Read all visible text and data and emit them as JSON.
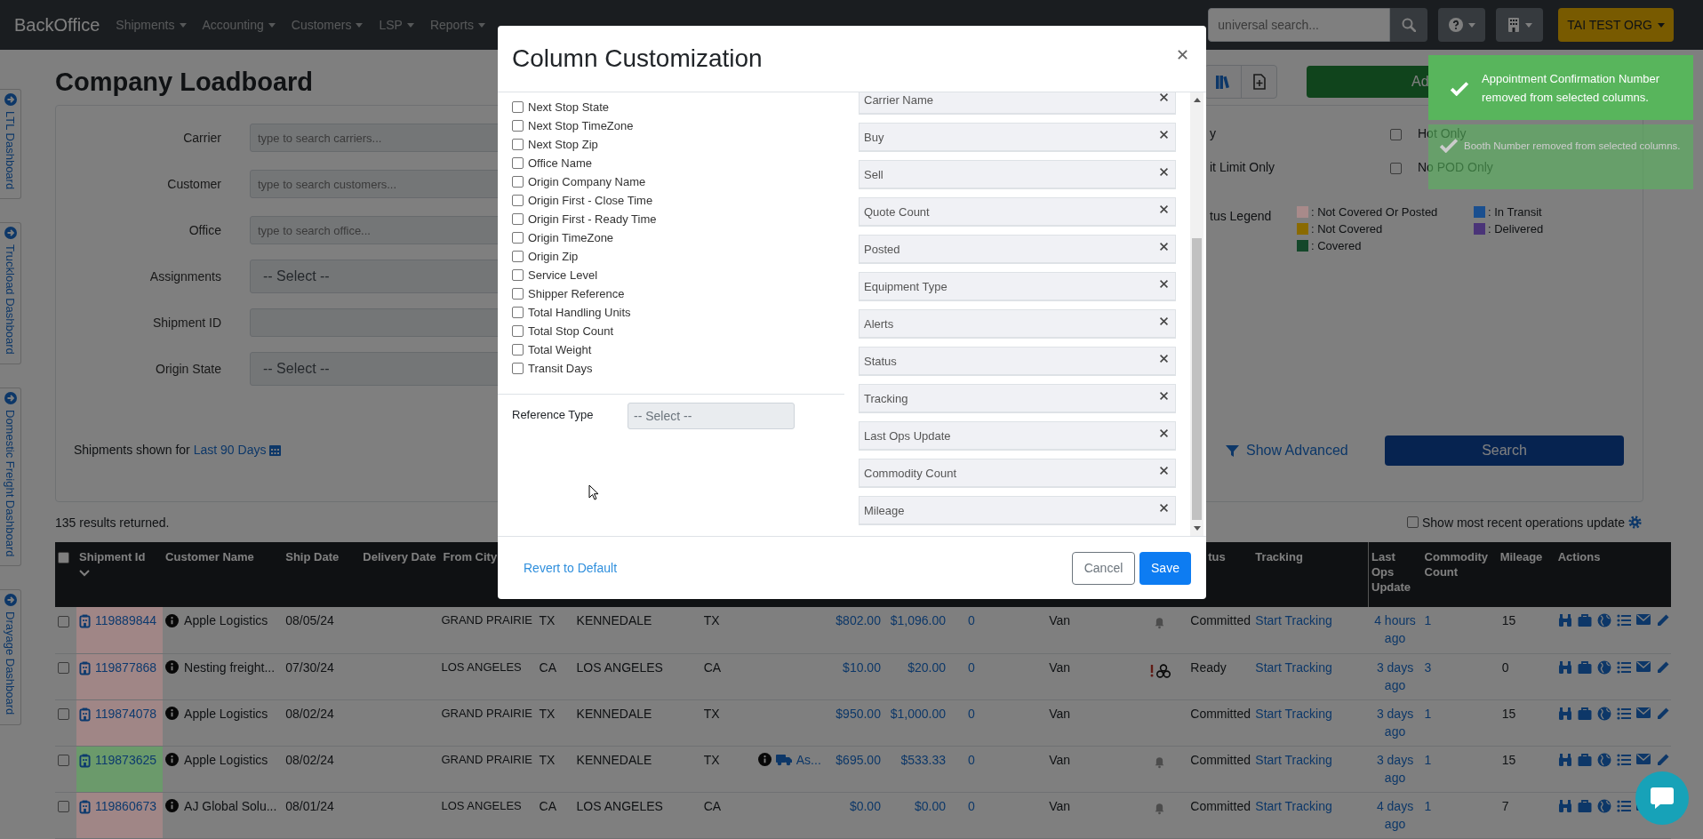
{
  "navbar": {
    "brand": "BackOffice",
    "menus": [
      {
        "label": "Shipments"
      },
      {
        "label": "Accounting"
      },
      {
        "label": "Customers"
      },
      {
        "label": "LSP"
      },
      {
        "label": "Reports"
      }
    ],
    "search": {
      "placeholder": "universal search..."
    },
    "org_button": "TAI TEST ORG"
  },
  "side_tabs": [
    {
      "label": "LTL Dashboard"
    },
    {
      "label": "Truckload Dashboard"
    },
    {
      "label": "Domestic Freight Dashboard"
    },
    {
      "label": "Drayage Dashboard"
    }
  ],
  "page": {
    "title": "Company Loadboard",
    "add_button": "Ad"
  },
  "filters": {
    "fields": [
      {
        "label": "Carrier",
        "kind": "text",
        "placeholder": "type to search carriers..."
      },
      {
        "label": "Customer",
        "kind": "text",
        "placeholder": "type to search customers..."
      },
      {
        "label": "Office",
        "kind": "text",
        "placeholder": "type to search office..."
      },
      {
        "label": "Assignments",
        "kind": "select",
        "value": "-- Select --"
      },
      {
        "label": "Shipment ID",
        "kind": "text"
      },
      {
        "label": "Origin State",
        "kind": "select",
        "value": "-- Select --"
      }
    ],
    "date_range": {
      "text": "Shipments shown for",
      "link": "Last 90 Days"
    },
    "options": [
      {
        "label": "y",
        "checkbox_label": "Hot Only",
        "checked": false
      },
      {
        "label": "it Limit Only",
        "checkbox_label": "No POD Only",
        "checked": false
      }
    ],
    "legend": {
      "label": "tus Legend",
      "items": [
        {
          "label": ": Not Covered Or Posted",
          "color": "#a88a8a"
        },
        {
          "label": ": In Transit",
          "color": "#1a4f8f"
        },
        {
          "label": ": Not Covered",
          "color": "#8a6a00"
        },
        {
          "label": ": Delivered",
          "color": "#4a3478"
        },
        {
          "label": ": Covered",
          "color": "#14472a"
        }
      ]
    },
    "show_advanced": "Show Advanced",
    "search_button": "Search"
  },
  "results": {
    "count": "135 results returned.",
    "recent_ops": {
      "label": "Show most recent operations update",
      "checked": false
    }
  },
  "table": {
    "select_all": {
      "checked": false
    },
    "columns": [
      {
        "label": "Shipment Id",
        "sorted": true
      },
      {
        "label": "Customer Name",
        "sorted": false
      },
      {
        "label": "Ship Date",
        "sorted": false
      },
      {
        "label": "Delivery Date",
        "sorted": false
      },
      {
        "label": "From City",
        "sorted": false
      },
      {
        "label": "tus",
        "sorted": false
      },
      {
        "label": "Tracking",
        "sorted": false
      },
      {
        "label": "Last Ops Update",
        "sorted": false
      },
      {
        "label": "Commodity Count",
        "sorted": false
      },
      {
        "label": "Mileage",
        "sorted": false
      },
      {
        "label": "Actions",
        "sorted": false
      }
    ],
    "rows": [
      {
        "checked": false,
        "id": "119889844",
        "color": "#a08686",
        "customer": "Apple Logistics",
        "ship_date": "08/05/24",
        "from_city": "GRAND PRAIRIE",
        "from_state": "TX",
        "to_city": "KENNEDALE",
        "to_state": "TX",
        "buy": "$802.00",
        "sell": "$1,096.00",
        "quote_count": "0",
        "equipment": "Van",
        "alert": {
          "kind": "bell"
        },
        "status": "Committed",
        "tracking": "Start Tracking",
        "last_ops_update": "4 hours ago",
        "commodity_count": "1",
        "mileage": "15"
      },
      {
        "checked": false,
        "id": "119877868",
        "color": "#a08686",
        "customer": "Nesting freight...",
        "ship_date": "07/30/24",
        "from_city": "LOS ANGELES",
        "from_state": "CA",
        "to_city": "LOS ANGELES",
        "to_state": "CA",
        "buy": "$10.00",
        "sell": "$20.00",
        "quote_count": "0",
        "equipment": "Van",
        "alert": {
          "kind": "warning"
        },
        "status": "Ready",
        "tracking": "Start Tracking",
        "last_ops_update": "3 days ago",
        "commodity_count": "3",
        "mileage": "0"
      },
      {
        "checked": false,
        "id": "119874078",
        "color": "#a08686",
        "customer": "Apple Logistics",
        "ship_date": "08/02/24",
        "from_city": "GRAND PRAIRIE",
        "from_state": "TX",
        "to_city": "KENNEDALE",
        "to_state": "TX",
        "buy": "$950.00",
        "sell": "$1,000.00",
        "quote_count": "0",
        "equipment": "Van",
        "status": "Committed",
        "tracking": "Start Tracking",
        "last_ops_update": "3 days ago",
        "commodity_count": "1",
        "mileage": "15"
      },
      {
        "checked": false,
        "id": "119873625",
        "color": "#6b9a6b",
        "customer": "Apple Logistics",
        "ship_date": "08/02/24",
        "from_city": "GRAND PRAIRIE",
        "from_state": "TX",
        "to_city": "KENNEDALE",
        "to_state": "TX",
        "column_10": "As...",
        "buy": "$695.00",
        "sell": "$533.33",
        "quote_count": "0",
        "equipment": "Van",
        "alert": {
          "kind": "bell"
        },
        "status": "Committed",
        "tracking": "Start Tracking",
        "last_ops_update": "3 days ago",
        "commodity_count": "1",
        "mileage": "15"
      },
      {
        "checked": false,
        "id": "119860673",
        "color": "#a08686",
        "customer": "AJ Global Solu...",
        "ship_date": "08/01/24",
        "from_city": "LOS ANGELES",
        "from_state": "CA",
        "to_city": "LOS ANGELES",
        "to_state": "CA",
        "buy": "$0.00",
        "sell": "$0.00",
        "quote_count": "0",
        "equipment": "Van",
        "alert": {
          "kind": "bell"
        },
        "status": "Committed",
        "tracking": "Start Tracking",
        "last_ops_update": "4 days ago",
        "commodity_count": "1",
        "mileage": "7"
      }
    ]
  },
  "modal": {
    "title": "Column Customization",
    "available_columns": [
      {
        "label": "Next Stop State",
        "checked": false
      },
      {
        "label": "Next Stop TimeZone",
        "checked": false
      },
      {
        "label": "Next Stop Zip",
        "checked": false
      },
      {
        "label": "Office Name",
        "checked": false
      },
      {
        "label": "Origin Company Name",
        "checked": false
      },
      {
        "label": "Origin First - Close Time",
        "checked": false
      },
      {
        "label": "Origin First - Ready Time",
        "checked": false
      },
      {
        "label": "Origin TimeZone",
        "checked": false
      },
      {
        "label": "Origin Zip",
        "checked": false
      },
      {
        "label": "Service Level",
        "checked": false
      },
      {
        "label": "Shipper Reference",
        "checked": false
      },
      {
        "label": "Total Handling Units",
        "checked": false
      },
      {
        "label": "Total Stop Count",
        "checked": false
      },
      {
        "label": "Total Weight",
        "checked": false
      },
      {
        "label": "Transit Days",
        "checked": false
      }
    ],
    "reference_type": {
      "label": "Reference Type",
      "value": "-- Select --"
    },
    "selected_columns": [
      "Carrier Name",
      "Buy",
      "Sell",
      "Quote Count",
      "Posted",
      "Equipment Type",
      "Alerts",
      "Status",
      "Tracking",
      "Last Ops Update",
      "Commodity Count",
      "Mileage"
    ],
    "revert_link": "Revert to Default",
    "cancel_button": "Cancel",
    "save_button": "Save"
  },
  "toasts": [
    {
      "message": "Appointment Confirmation Number removed from selected columns.",
      "faded": false
    },
    {
      "message": "Booth Number removed from selected columns.",
      "faded": true
    }
  ]
}
